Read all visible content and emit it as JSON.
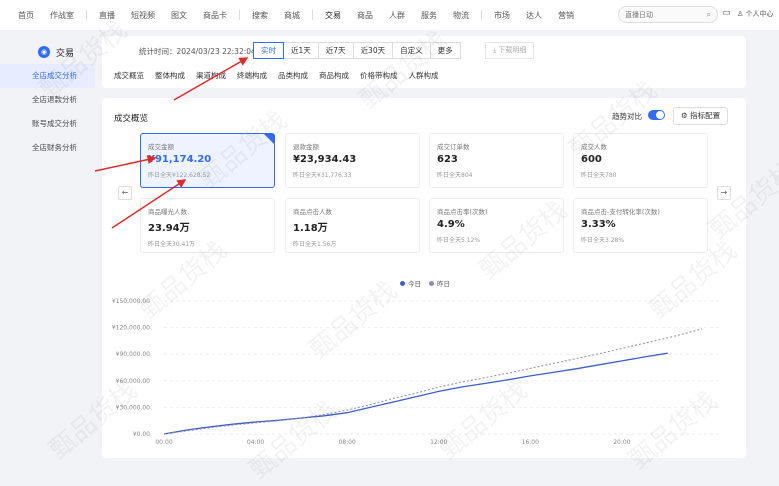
{
  "topnav": {
    "groups": [
      [
        "首页",
        "作战室"
      ],
      [
        "直播",
        "短视频",
        "图文",
        "商品卡"
      ],
      [
        "搜索",
        "商城"
      ],
      [
        "交易",
        "商品",
        "人群",
        "服务",
        "物流"
      ],
      [
        "市场",
        "达人",
        "营销"
      ]
    ],
    "search_placeholder": "直播日动",
    "user_label": "个人中心"
  },
  "sidebar": {
    "title": "交易",
    "items": [
      "全店成交分析",
      "全店退款分析",
      "账号成交分析",
      "全店财务分析"
    ]
  },
  "filter": {
    "stat_time": "统计时间：2024/03/23 22:32:04",
    "ranges": [
      "实时",
      "近1天",
      "近7天",
      "近30天",
      "自定义",
      "更多"
    ],
    "download": "下载明细",
    "subtabs": [
      "成交概览",
      "整体构成",
      "渠道构成",
      "终端构成",
      "品类构成",
      "商品构成",
      "价格带构成",
      "人群构成"
    ]
  },
  "overview": {
    "title": "成交概览",
    "trend_label": "趋势对比",
    "config_label": "指标配置",
    "metrics": [
      {
        "label": "成交金额",
        "value": "¥91,174.20",
        "prev": "昨日全天¥122,628.52"
      },
      {
        "label": "退款金额",
        "value": "¥23,934.43",
        "prev": "昨日全天¥31,776.33"
      },
      {
        "label": "成交订单数",
        "value": "623",
        "prev": "昨日全天804"
      },
      {
        "label": "成交人数",
        "value": "600",
        "prev": "昨日全天780"
      },
      {
        "label": "商品曝光人数",
        "value": "23.94万",
        "prev": "昨日全天30.41万"
      },
      {
        "label": "商品点击人数",
        "value": "1.18万",
        "prev": "昨日全天1.56万"
      },
      {
        "label": "商品点击率(次数)",
        "value": "4.9%",
        "prev": "昨日全天5.12%"
      },
      {
        "label": "商品点击-支付转化率(次数)",
        "value": "3.33%",
        "prev": "昨日全天3.28%"
      }
    ]
  },
  "colors": {
    "accent": "#2f6bff",
    "today": "#3a5fcd",
    "yesterday": "#8b8fa3"
  },
  "watermark": "甄品货栈",
  "chart_data": {
    "type": "line",
    "xlabel": "",
    "ylabel": "",
    "x_ticks": [
      "00:00",
      "04:00",
      "08:00",
      "12:00",
      "16:00",
      "20:00"
    ],
    "y_ticks": [
      "¥0.00",
      "¥30,000.00",
      "¥60,000.00",
      "¥90,000.00",
      "¥120,000.00",
      "¥150,000.00"
    ],
    "ylim": [
      0,
      150000
    ],
    "xlim": [
      0,
      23.5
    ],
    "grid": true,
    "legend_position": "top-center",
    "series": [
      {
        "name": "今日",
        "color": "#3a5fcd",
        "dashed": false,
        "x": [
          0,
          1,
          2,
          3,
          4,
          5,
          6,
          7,
          8,
          9,
          10,
          11,
          12,
          13,
          14,
          15,
          16,
          17,
          18,
          19,
          20,
          21,
          22
        ],
        "y": [
          0,
          4500,
          8000,
          11000,
          13500,
          15500,
          18000,
          20500,
          24000,
          30000,
          36000,
          42000,
          48000,
          53000,
          57000,
          61000,
          65500,
          69500,
          73500,
          78000,
          82500,
          87000,
          91174
        ]
      },
      {
        "name": "昨日",
        "color": "#8b8fa3",
        "dashed": true,
        "x": [
          0,
          1,
          2,
          3,
          4,
          5,
          6,
          7,
          8,
          9,
          10,
          11,
          12,
          13,
          14,
          15,
          16,
          17,
          18,
          19,
          20,
          21,
          22,
          23,
          23.5
        ],
        "y": [
          0,
          3500,
          7000,
          10000,
          12500,
          15000,
          18000,
          22000,
          27000,
          33000,
          40000,
          46000,
          53000,
          58500,
          63500,
          68500,
          74000,
          79500,
          85000,
          90500,
          96500,
          102500,
          108500,
          115000,
          118500
        ]
      }
    ]
  }
}
